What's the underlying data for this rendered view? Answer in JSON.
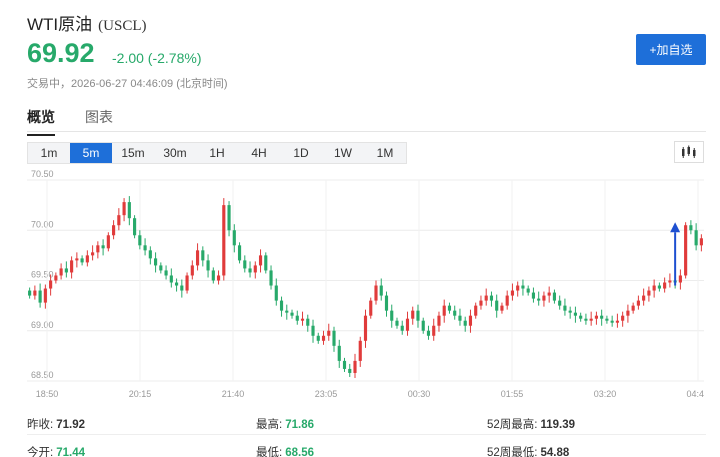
{
  "header": {
    "name": "WTI原油",
    "code": "(USCL)",
    "price": "69.92",
    "change": "-2.00 (-2.78%)",
    "status": "交易中，2026-06-27 04:46:09 (北京时间)",
    "add_button": "+加自选"
  },
  "tabs": [
    {
      "label": "概览",
      "active": true
    },
    {
      "label": "图表",
      "active": false
    }
  ],
  "periods": [
    {
      "label": "1m",
      "active": false
    },
    {
      "label": "5m",
      "active": true
    },
    {
      "label": "15m",
      "active": false
    },
    {
      "label": "30m",
      "active": false
    },
    {
      "label": "1H",
      "active": false
    },
    {
      "label": "4H",
      "active": false
    },
    {
      "label": "1D",
      "active": false
    },
    {
      "label": "1W",
      "active": false
    },
    {
      "label": "1M",
      "active": false
    }
  ],
  "chart_data": {
    "type": "candlestick",
    "y_ticks": [
      "70.50",
      "70.00",
      "69.50",
      "69.00",
      "68.50"
    ],
    "ylim": [
      68.5,
      70.5
    ],
    "x_ticks": [
      "18:50",
      "20:15",
      "21:40",
      "23:05",
      "00:30",
      "01:55",
      "03:20",
      "04:4"
    ],
    "grid": true,
    "up_color": "#e03b3b",
    "down_color": "#27a96a",
    "close_series": [
      69.35,
      69.4,
      69.28,
      69.42,
      69.5,
      69.55,
      69.62,
      69.58,
      69.7,
      69.72,
      69.68,
      69.75,
      69.78,
      69.85,
      69.82,
      69.95,
      70.05,
      70.15,
      70.28,
      70.12,
      69.95,
      69.85,
      69.8,
      69.72,
      69.65,
      69.6,
      69.55,
      69.48,
      69.45,
      69.4,
      69.55,
      69.65,
      69.8,
      69.7,
      69.6,
      69.5,
      69.55,
      70.25,
      70.0,
      69.85,
      69.7,
      69.62,
      69.58,
      69.65,
      69.75,
      69.6,
      69.45,
      69.3,
      69.2,
      69.18,
      69.15,
      69.1,
      69.12,
      69.05,
      68.95,
      68.9,
      68.95,
      69.0,
      68.85,
      68.7,
      68.62,
      68.58,
      68.7,
      68.9,
      69.15,
      69.3,
      69.45,
      69.35,
      69.2,
      69.1,
      69.05,
      69.0,
      69.12,
      69.2,
      69.1,
      69.0,
      68.95,
      69.05,
      69.15,
      69.25,
      69.2,
      69.15,
      69.1,
      69.05,
      69.15,
      69.25,
      69.3,
      69.35,
      69.3,
      69.2,
      69.25,
      69.35,
      69.4,
      69.45,
      69.42,
      69.38,
      69.32,
      69.3,
      69.35,
      69.38,
      69.3,
      69.25,
      69.2,
      69.18,
      69.15,
      69.12,
      69.1,
      69.12,
      69.15,
      69.12,
      69.1,
      69.08,
      69.1,
      69.15,
      69.2,
      69.25,
      69.3,
      69.35,
      69.4,
      69.45,
      69.42,
      69.48,
      69.5,
      69.48,
      69.55,
      70.05,
      70.0,
      69.85,
      69.92
    ]
  },
  "stats": [
    {
      "label": "昨收:",
      "value": "71.92",
      "tone": "neutral"
    },
    {
      "label": "最高:",
      "value": "71.86",
      "tone": "down"
    },
    {
      "label": "52周最高:",
      "value": "119.39",
      "tone": "neutral"
    },
    {
      "label": "今开:",
      "value": "71.44",
      "tone": "down"
    },
    {
      "label": "最低:",
      "value": "68.56",
      "tone": "down"
    },
    {
      "label": "52周最低:",
      "value": "54.88",
      "tone": "neutral"
    }
  ]
}
